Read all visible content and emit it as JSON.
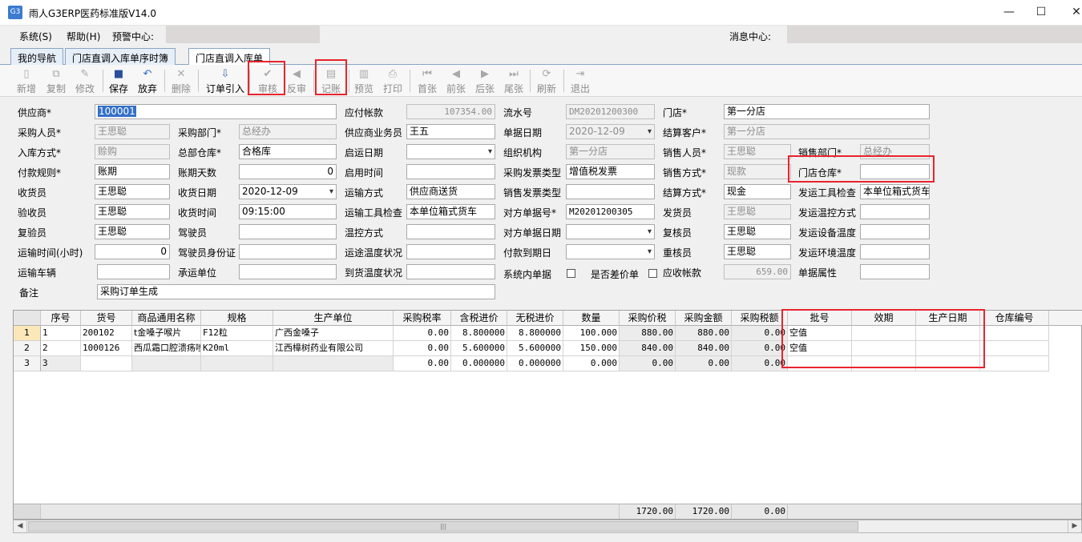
{
  "window": {
    "title": "雨人G3ERP医药标准版V14.0",
    "icon_text": "G3",
    "min": "—",
    "max": "☐",
    "close": "✕"
  },
  "menu": {
    "system": "系统(S)",
    "help": "帮助(H)",
    "alert": "预警中心:",
    "message": "消息中心:"
  },
  "tabs": [
    "我的导航",
    "门店直调入库单序时簿",
    "门店直调入库单"
  ],
  "toolbar": [
    {
      "label": "新增",
      "icon": "new-icon",
      "glyph": "▯",
      "disabled": true
    },
    {
      "label": "复制",
      "icon": "copy-icon",
      "glyph": "⧉",
      "disabled": true
    },
    {
      "label": "修改",
      "icon": "edit-icon",
      "glyph": "✎",
      "disabled": true
    },
    {
      "label": "保存",
      "icon": "save-icon",
      "glyph": "■",
      "disabled": false
    },
    {
      "label": "放弃",
      "icon": "undo-icon",
      "glyph": "↶",
      "disabled": false
    },
    {
      "label": "删除",
      "icon": "delete-icon",
      "glyph": "✕",
      "disabled": true
    },
    {
      "label": "订单引入",
      "icon": "import-icon",
      "glyph": "⇩",
      "disabled": false
    },
    {
      "label": "审核",
      "icon": "audit-icon",
      "glyph": "✔",
      "disabled": true
    },
    {
      "label": "反审",
      "icon": "unaudit-icon",
      "glyph": "◀",
      "disabled": true
    },
    {
      "label": "记账",
      "icon": "post-icon",
      "glyph": "▤",
      "disabled": true
    },
    {
      "label": "预览",
      "icon": "preview-icon",
      "glyph": "▥",
      "disabled": true
    },
    {
      "label": "打印",
      "icon": "print-icon",
      "glyph": "⎙",
      "disabled": true
    },
    {
      "label": "首张",
      "icon": "first-icon",
      "glyph": "⏮",
      "disabled": true
    },
    {
      "label": "前张",
      "icon": "prev-icon",
      "glyph": "◀",
      "disabled": true
    },
    {
      "label": "后张",
      "icon": "next-icon",
      "glyph": "▶",
      "disabled": true
    },
    {
      "label": "尾张",
      "icon": "last-icon",
      "glyph": "⏭",
      "disabled": true
    },
    {
      "label": "刷新",
      "icon": "refresh-icon",
      "glyph": "⟳",
      "disabled": true
    },
    {
      "label": "退出",
      "icon": "exit-icon",
      "glyph": "⇥",
      "disabled": true
    }
  ],
  "form": {
    "supplier": {
      "label": "供应商*",
      "value": "100001"
    },
    "payable": {
      "label": "应付帐款",
      "value": "107354.00"
    },
    "serial_no": {
      "label": "流水号",
      "value": "DM20201200300"
    },
    "store": {
      "label": "门店*",
      "value": "第一分店"
    },
    "buyer": {
      "label": "采购人员*",
      "value": "王思聪"
    },
    "buy_dept": {
      "label": "采购部门*",
      "value": "总经办"
    },
    "supplier_rep": {
      "label": "供应商业务员",
      "value": "王五"
    },
    "doc_date": {
      "label": "单据日期",
      "value": "2020-12-09"
    },
    "settle_customer": {
      "label": "结算客户*",
      "value": "第一分店"
    },
    "stock_in_type": {
      "label": "入库方式*",
      "value": "赊购"
    },
    "hq_warehouse": {
      "label": "总部仓库*",
      "value": "合格库"
    },
    "ship_date": {
      "label": "启运日期",
      "value": ""
    },
    "org": {
      "label": "组织机构",
      "value": "第一分店"
    },
    "salesman": {
      "label": "销售人员*",
      "value": "王思聪"
    },
    "sales_dept": {
      "label": "销售部门*",
      "value": "总经办"
    },
    "pay_rule": {
      "label": "付款规则*",
      "value": "账期"
    },
    "credit_days": {
      "label": "账期天数",
      "value": "0"
    },
    "enable_time": {
      "label": "启用时间",
      "value": ""
    },
    "purchase_invoice": {
      "label": "采购发票类型",
      "value": "增值税发票"
    },
    "sales_method": {
      "label": "销售方式*",
      "value": "现款"
    },
    "store_warehouse": {
      "label": "门店仓库*",
      "value": ""
    },
    "receiver": {
      "label": "收货员",
      "value": "王思聪"
    },
    "receive_date": {
      "label": "收货日期",
      "value": "2020-12-09"
    },
    "transport": {
      "label": "运输方式",
      "value": "供应商送货"
    },
    "sales_invoice": {
      "label": "销售发票类型",
      "value": ""
    },
    "settle_method": {
      "label": "结算方式*",
      "value": "现金"
    },
    "ship_tool_check": {
      "label": "发运工具检查",
      "value": "本单位箱式货车"
    },
    "inspector": {
      "label": "验收员",
      "value": "王思聪"
    },
    "receive_time": {
      "label": "收货时间",
      "value": "09:15:00"
    },
    "transport_tool_check": {
      "label": "运输工具检查",
      "value": "本单位箱式货车"
    },
    "counter_doc_no": {
      "label": "对方单据号*",
      "value": "M20201200305"
    },
    "shipper": {
      "label": "发货员",
      "value": "王思聪"
    },
    "ship_temp_method": {
      "label": "发运温控方式",
      "value": ""
    },
    "rechecker": {
      "label": "复验员",
      "value": "王思聪"
    },
    "driver": {
      "label": "驾驶员",
      "value": ""
    },
    "temp_method": {
      "label": "温控方式",
      "value": ""
    },
    "counter_doc_date": {
      "label": "对方单据日期",
      "value": ""
    },
    "reviewer": {
      "label": "复核员",
      "value": "王思聪"
    },
    "ship_device_temp": {
      "label": "发运设备温度",
      "value": ""
    },
    "transport_hours": {
      "label": "运输时间(小时)",
      "value": "0"
    },
    "driver_id": {
      "label": "驾驶员身份证",
      "value": ""
    },
    "route_temp": {
      "label": "运途温度状况",
      "value": ""
    },
    "pay_due": {
      "label": "付款到期日",
      "value": ""
    },
    "reweigher": {
      "label": "重核员",
      "value": "王思聪"
    },
    "ship_env_temp": {
      "label": "发运环境温度",
      "value": ""
    },
    "vehicle": {
      "label": "运输车辆",
      "value": ""
    },
    "carrier": {
      "label": "承运单位",
      "value": ""
    },
    "arrival_temp": {
      "label": "到货温度状况",
      "value": ""
    },
    "internal_doc": {
      "label": "系统内单据"
    },
    "price_diff": {
      "label": "是否差价单"
    },
    "receivable": {
      "label": "应收帐款",
      "value": "659.00"
    },
    "doc_attr": {
      "label": "单据属性",
      "value": ""
    },
    "remark": {
      "label": "备注",
      "value": "采购订单生成"
    }
  },
  "grid": {
    "columns": [
      "序号",
      "货号",
      "商品通用名称",
      "规格",
      "生产单位",
      "采购税率",
      "含税进价",
      "无税进价",
      "数量",
      "采购价税",
      "采购金额",
      "采购税额",
      "批号",
      "效期",
      "生产日期",
      "仓库编号"
    ],
    "rows": [
      [
        "1",
        "200102",
        "t金嗓子喉片",
        "F12粒",
        "广西金嗓子",
        "0.00",
        "8.800000",
        "8.800000",
        "100.000",
        "880.00",
        "880.00",
        "0.00",
        "空值",
        "",
        "",
        ""
      ],
      [
        "2",
        "1000126",
        "西瓜霜口腔溃疡喷",
        "K20ml",
        "江西樟树药业有限公司",
        "0.00",
        "5.600000",
        "5.600000",
        "150.000",
        "840.00",
        "840.00",
        "0.00",
        "空值",
        "",
        "",
        ""
      ],
      [
        "3",
        "",
        "",
        "",
        "",
        "0.00",
        "0.000000",
        "0.000000",
        "0.000",
        "0.00",
        "0.00",
        "0.00",
        "",
        "",
        "",
        ""
      ]
    ],
    "row_numbers": [
      "1",
      "2",
      "3"
    ],
    "footer": {
      "price_tax": "1720.00",
      "amount": "1720.00",
      "tax": "0.00"
    }
  },
  "scroll": {
    "left": "◀",
    "right": "▶",
    "grip": "|||"
  }
}
